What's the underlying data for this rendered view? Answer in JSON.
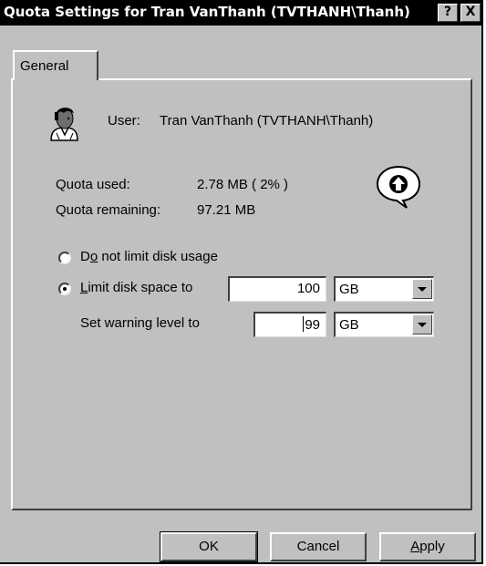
{
  "window": {
    "title": "Quota Settings for Tran VanThanh (TVTHANH\\Thanh)",
    "help_label": "?",
    "close_label": "X"
  },
  "tabs": [
    {
      "label": "General"
    }
  ],
  "user": {
    "label": "User:",
    "value": "Tran VanThanh (TVTHANH\\Thanh)"
  },
  "quota": {
    "used_label": "Quota used:",
    "used_value": "2.78 MB ( 2% )",
    "remaining_label": "Quota remaining:",
    "remaining_value": "97.21 MB"
  },
  "options": {
    "no_limit": {
      "prefix": "D",
      "mnemonic": "o",
      "suffix": " not limit disk usage",
      "selected": false
    },
    "limit": {
      "mnemonic": "L",
      "suffix": "imit disk space to",
      "selected": true,
      "value": "100",
      "unit": "GB"
    },
    "warning": {
      "label": "Set warning level to",
      "value": "99",
      "unit": "GB"
    }
  },
  "buttons": {
    "ok": "OK",
    "cancel": "Cancel",
    "apply_mnemonic": "A",
    "apply_rest": "pply"
  }
}
